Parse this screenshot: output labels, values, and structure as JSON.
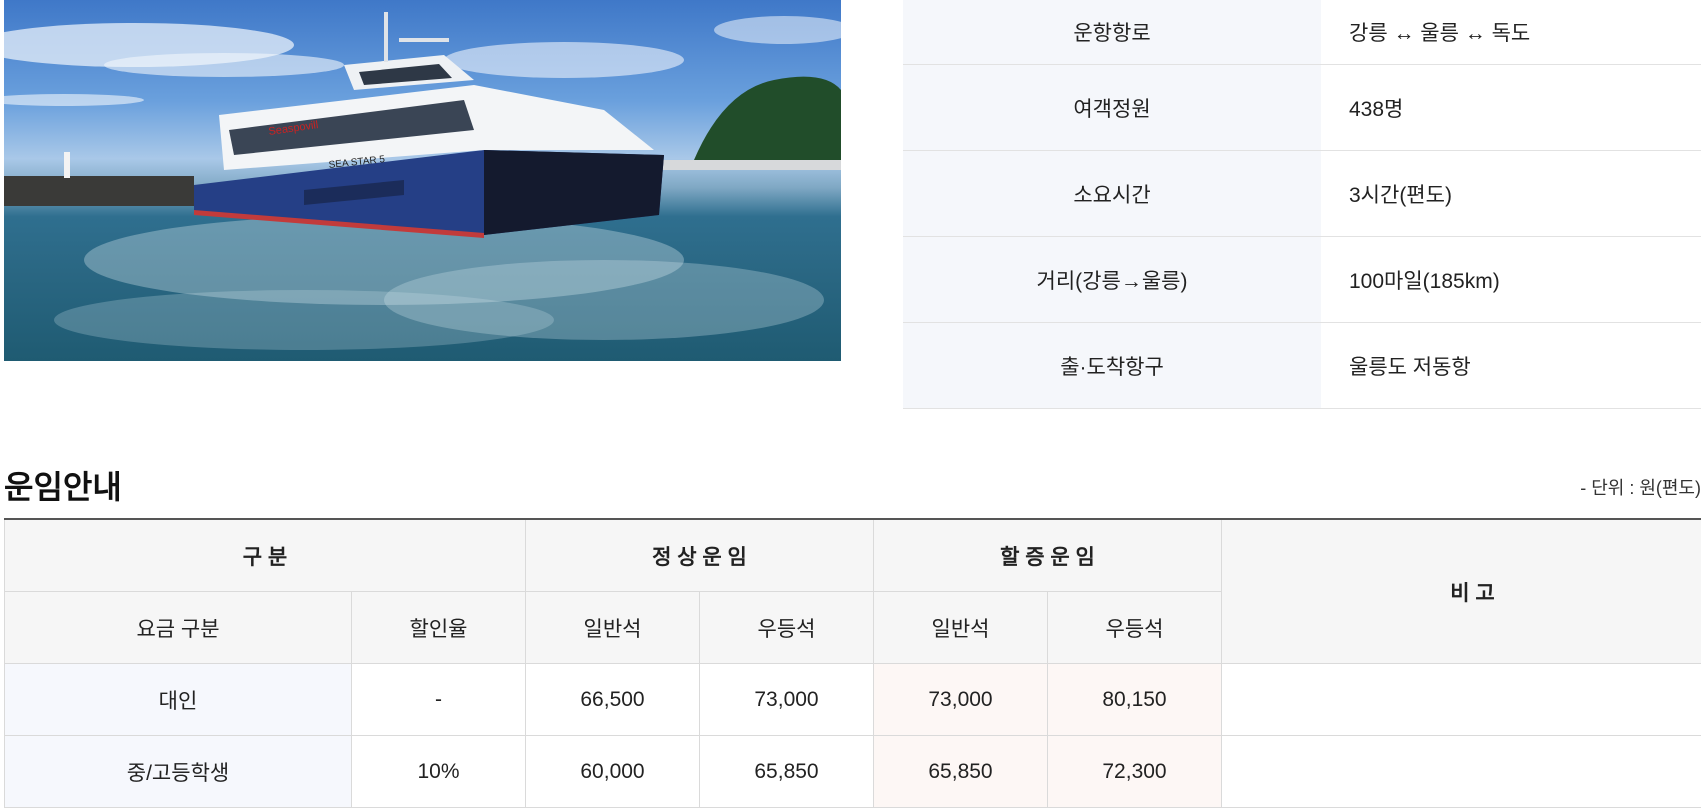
{
  "photo": {
    "alt": "ship-photo",
    "hull_text": "SEA STAR 5",
    "brand_text": "Seaspovill"
  },
  "info": {
    "rows": [
      {
        "label": "운항항로",
        "value": "강릉 ↔ 울릉 ↔ 독도"
      },
      {
        "label": "여객정원",
        "value": "438명"
      },
      {
        "label": "소요시간",
        "value": "3시간(편도)"
      },
      {
        "label": "거리(강릉→울릉)",
        "value": "100마일(185km)"
      },
      {
        "label": "출·도착항구",
        "value": "울릉도 저동항"
      }
    ]
  },
  "fare": {
    "title": "운임안내",
    "unit": "- 단위 : 원(편도)",
    "header": {
      "category": "구 분",
      "normal": "정 상 운 임",
      "surge": "할 증 운 임",
      "note": "비 고",
      "fare_type": "요금 구분",
      "discount": "할인율",
      "normal_general": "일반석",
      "normal_premium": "우등석",
      "surge_general": "일반석",
      "surge_premium": "우등석"
    },
    "rows": [
      {
        "type": "대인",
        "discount": "-",
        "normal_general": "66,500",
        "normal_premium": "73,000",
        "surge_general": "73,000",
        "surge_premium": "80,150",
        "note": ""
      },
      {
        "type": "중/고등학생",
        "discount": "10%",
        "normal_general": "60,000",
        "normal_premium": "65,850",
        "surge_general": "65,850",
        "surge_premium": "72,300",
        "note": ""
      }
    ]
  }
}
